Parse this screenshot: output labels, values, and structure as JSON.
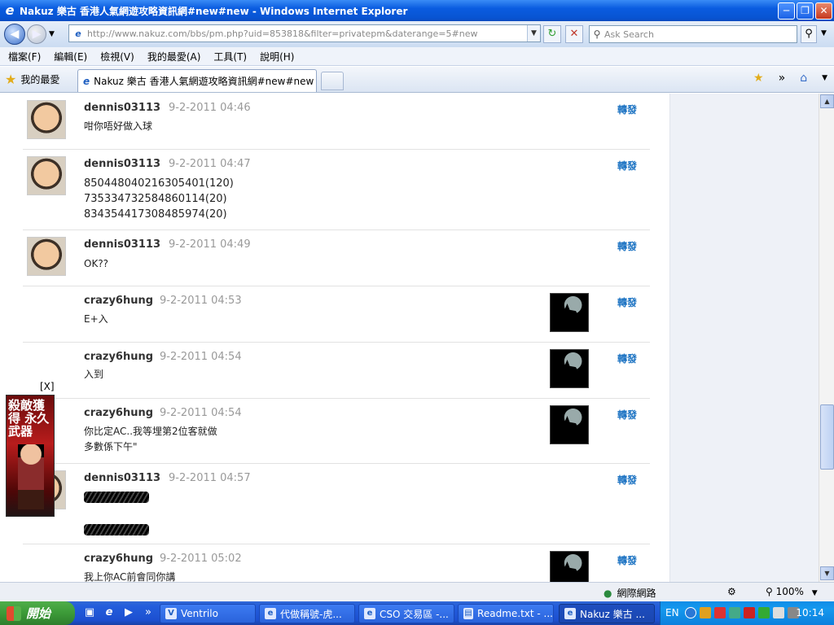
{
  "window": {
    "title": "Nakuz 樂古 香港人氣網遊攻略資訊網#new#new - Windows Internet Explorer"
  },
  "nav": {
    "url": "http://www.nakuz.com/bbs/pm.php?uid=853818&filter=privatepm&daterange=5#new",
    "search_placeholder": "Ask Search"
  },
  "menu": [
    "檔案(F)",
    "編輯(E)",
    "檢視(V)",
    "我的最愛(A)",
    "工具(T)",
    "說明(H)"
  ],
  "favorites": {
    "label": "我的最愛"
  },
  "tab": {
    "label": "Nakuz 樂古 香港人氣網遊攻略資訊網#new#new"
  },
  "forward_label": "轉發",
  "messages": [
    {
      "user": "dennis03113",
      "time": "9-2-2011 04:46",
      "lines": [
        "咁你唔好做入球"
      ]
    },
    {
      "user": "dennis03113",
      "time": "9-2-2011 04:47",
      "lines": [
        "850448040216305401(120)",
        "735334732584860114(20)",
        "834354417308485974(20)"
      ]
    },
    {
      "user": "dennis03113",
      "time": "9-2-2011 04:49",
      "lines": [
        "OK??"
      ]
    },
    {
      "user": "crazy6hung",
      "time": "9-2-2011 04:53",
      "lines": [
        "E+入"
      ]
    },
    {
      "user": "crazy6hung",
      "time": "9-2-2011 04:54",
      "lines": [
        "入到"
      ]
    },
    {
      "user": "crazy6hung",
      "time": "9-2-2011 04:54",
      "lines": [
        "你比定AC..我等埋第2位客就做",
        "多數係下午\""
      ]
    },
    {
      "user": "dennis03113",
      "time": "9-2-2011 04:57",
      "lines": []
    },
    {
      "user": "crazy6hung",
      "time": "9-2-2011 05:02",
      "lines": [
        "我上你AC前會同你講"
      ]
    }
  ],
  "ad": {
    "close": "[X]",
    "text": "殺敵獲得 永久武器"
  },
  "status": {
    "zone": "網際網路",
    "zoom": "100%"
  },
  "taskbar": {
    "start": "開始",
    "tasks": [
      "Ventrilo",
      "代做稱號-虎...",
      "CSO 交易區 -...",
      "Readme.txt - ...",
      "Nakuz 樂古 ..."
    ],
    "lang": "EN",
    "clock": "10:14"
  }
}
